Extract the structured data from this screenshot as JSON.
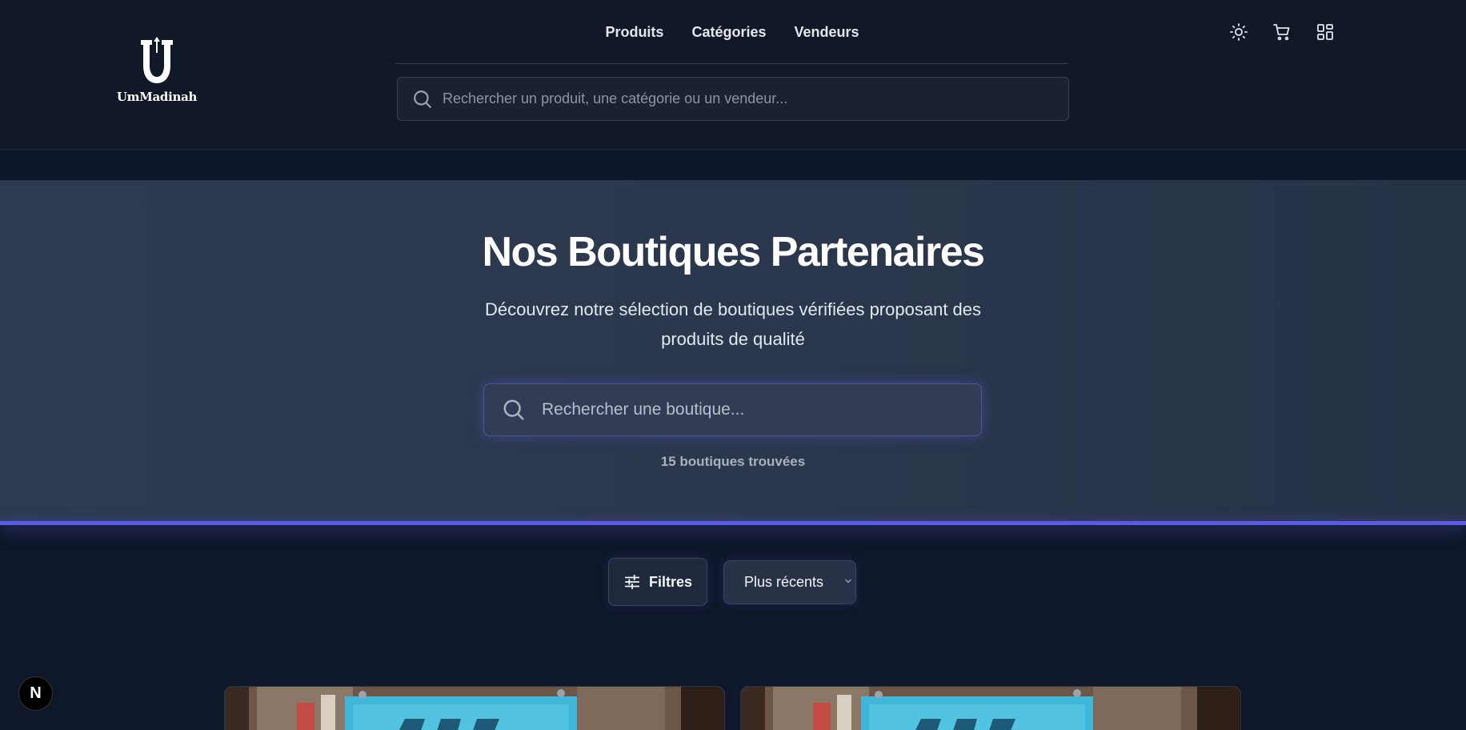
{
  "brand": {
    "logo_text": "UmMadinah"
  },
  "nav": {
    "items": [
      "Produits",
      "Catégories",
      "Vendeurs"
    ]
  },
  "top_search": {
    "placeholder": "Rechercher un produit, une catégorie ou un vendeur..."
  },
  "header_icons": [
    "sun-icon",
    "cart-icon",
    "grid-icon"
  ],
  "hero": {
    "title": "Nos Boutiques Partenaires",
    "subtitle": "Découvrez notre sélection de boutiques vérifiées proposant des produits de qualité",
    "search_placeholder": "Rechercher une boutique...",
    "count": "15 boutiques trouvées"
  },
  "controls": {
    "filters_label": "Filtres",
    "sort_value": "Plus récents"
  },
  "floating_badge": {
    "label": "N"
  },
  "colors": {
    "background": "#0f172a",
    "header": "#111827",
    "hero": "#2b374c",
    "accent": "#5b5be6"
  }
}
